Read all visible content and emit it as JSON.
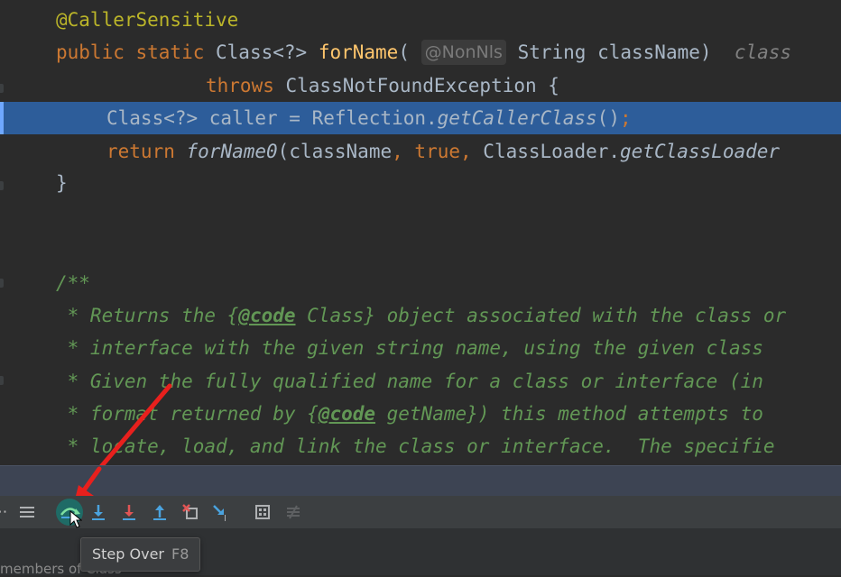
{
  "code": {
    "annotation": "@CallerSensitive",
    "sig_mods": "public static ",
    "sig_type": "Class<?> ",
    "sig_fn": "forName",
    "sig_paren": "(",
    "sig_hint": "@NonNls",
    "sig_params": "String className)",
    "sig_trail": "class",
    "throws_kw": "throws",
    "throws_rest": " ClassNotFoundException {",
    "caller_a": "Class<?> caller = Reflection.",
    "caller_fn": "getCallerClass",
    "caller_b": "()",
    "caller_semi": ";",
    "ret_kw": "return",
    "ret_fn": "forName0",
    "ret_a": "(className",
    "ret_comma1": ",",
    "ret_true": "true",
    "ret_comma2": ",",
    "ret_b": " ClassLoader.",
    "ret_fn2": "getClassLoader",
    "close_brace": "}",
    "doc_open": "/**",
    "doc1_a": " * Returns the {",
    "doc1_tag": "@code",
    "doc1_b": " Class} object associated with the class or",
    "doc2": " * interface with the given string name, using the given class",
    "doc3": " * Given the fully qualified name for a class or interface (in",
    "doc4_a": " * format returned by {",
    "doc4_tag": "@code",
    "doc4_b": " getName}) this method attempts to",
    "doc5": " * locate, load, and link the class or interface.  The specifie"
  },
  "toolbar": {
    "icons": [
      "layout-icon",
      "step-over-icon",
      "step-into-icon",
      "force-step-into-icon",
      "step-out-icon",
      "drop-frame-icon",
      "run-to-cursor-icon",
      "evaluate-expression-icon",
      "trace-icon"
    ]
  },
  "tooltip": {
    "label": "Step Over",
    "shortcut": "F8"
  },
  "bottom": {
    "partial_text": "members of Class"
  },
  "colors": {
    "highlight": "#2d5d9a",
    "keyword": "#cc7832",
    "function": "#ffc66d",
    "doc": "#629755"
  }
}
